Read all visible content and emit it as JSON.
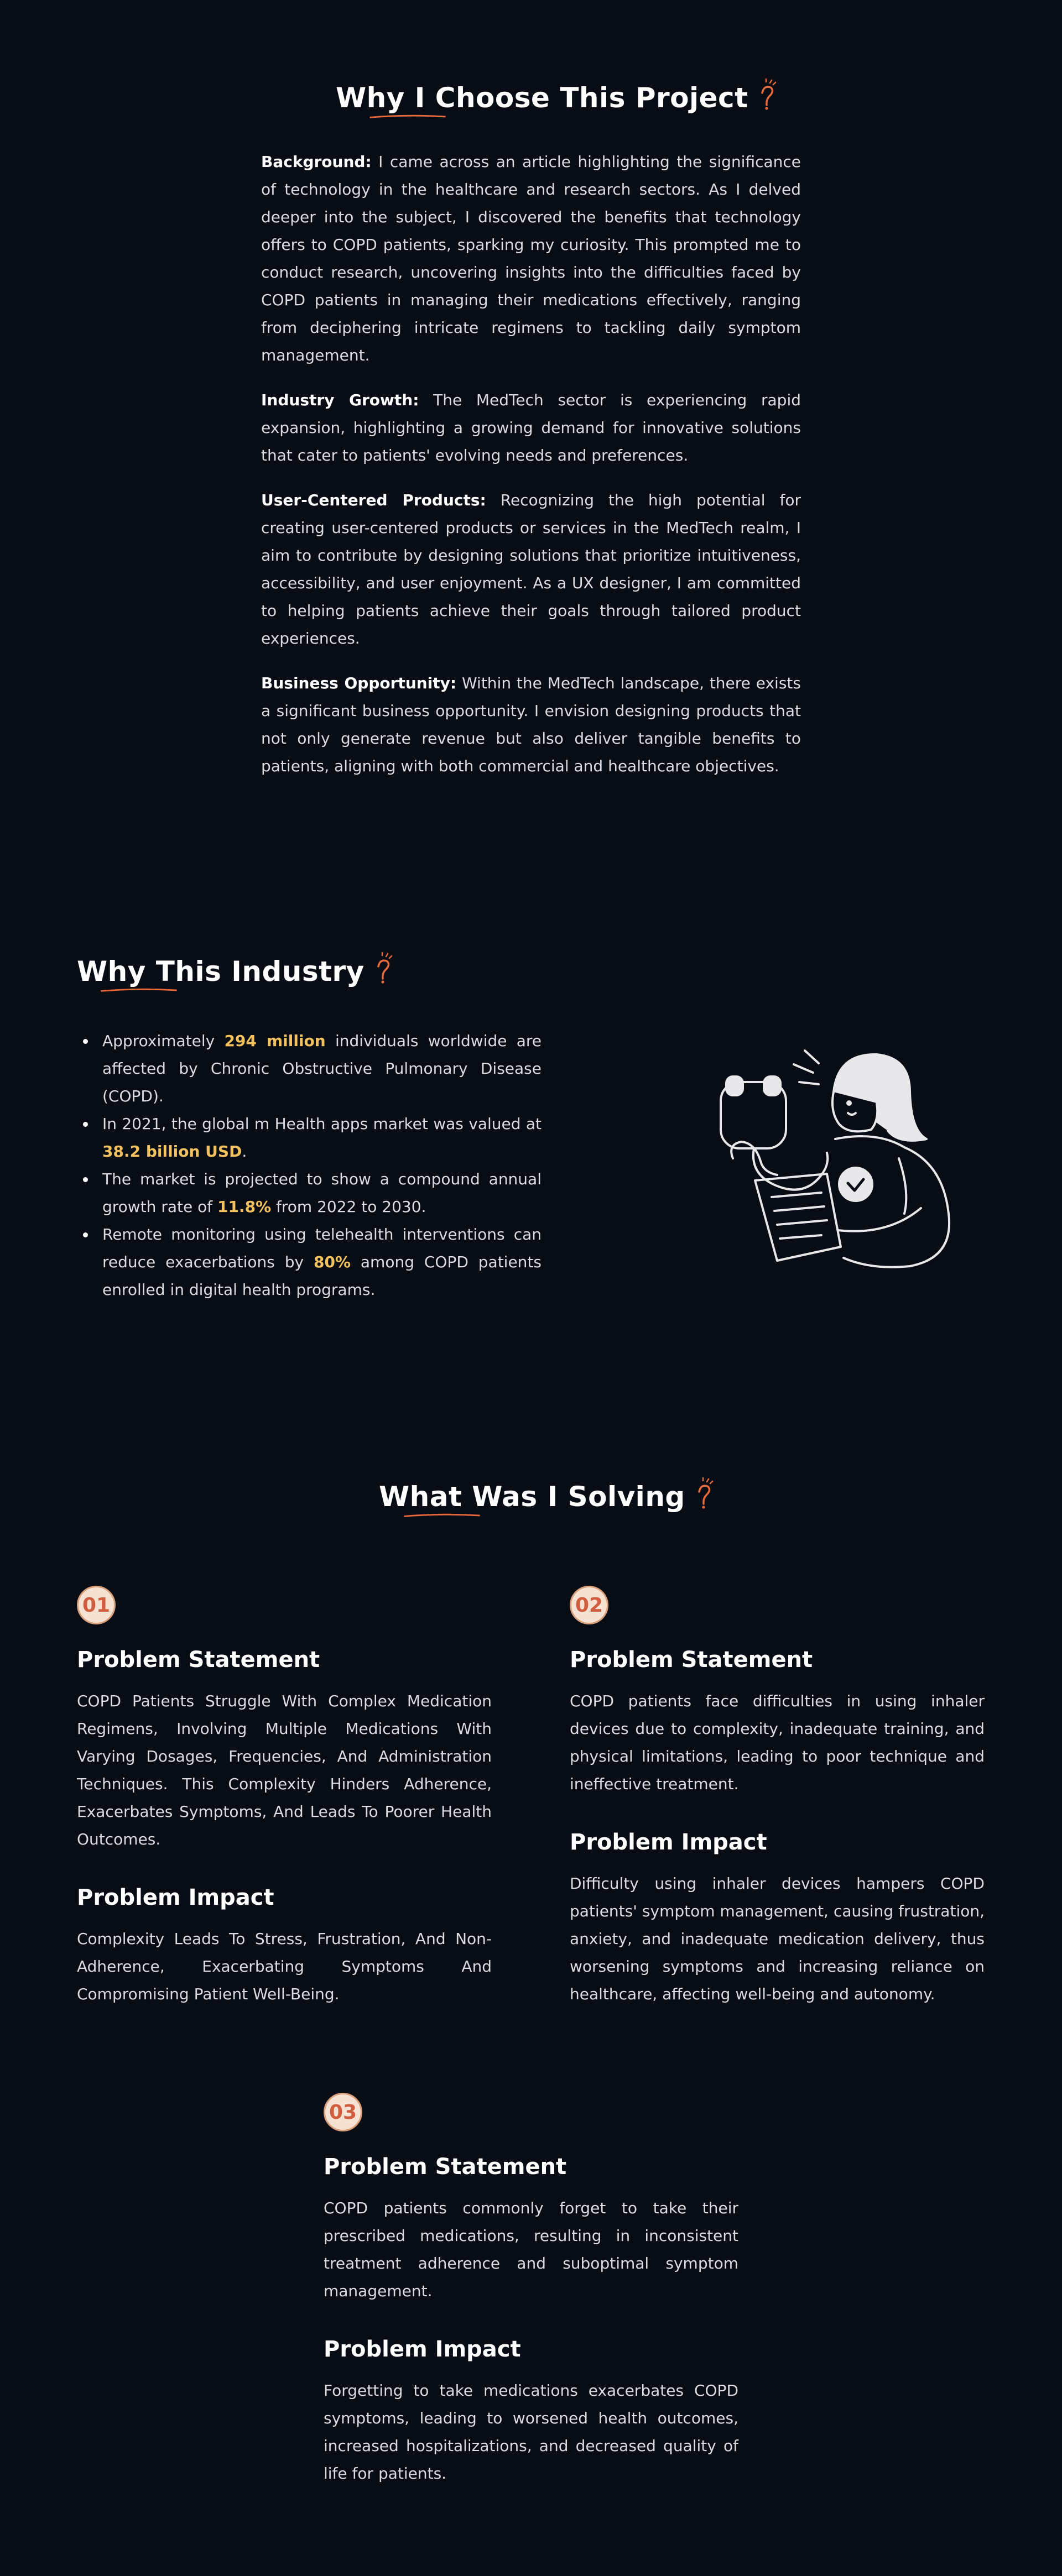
{
  "colors": {
    "background": "#080c15",
    "accent": "#e66a3c",
    "highlight": "#f3c25e",
    "badge_bg": "#f6e2d3",
    "badge_text": "#d05d3d"
  },
  "project": {
    "title": "Why I Choose This Project",
    "paragraphs": [
      {
        "label": "Background:",
        "text": " I came across an article highlighting the significance of technology in the healthcare and research sectors. As I delved deeper into the subject, I discovered the benefits that technology offers to COPD patients, sparking my curiosity. This prompted me to conduct research, uncovering insights into the difficulties faced by COPD patients in managing their medications effectively, ranging from deciphering intricate regimens to tackling daily symptom management."
      },
      {
        "label": "Industry Growth:",
        "text": " The MedTech sector is experiencing rapid expansion, highlighting a growing demand for innovative solutions that cater to patients' evolving needs and preferences."
      },
      {
        "label": "User-Centered Products:",
        "text": " Recognizing the high potential for creating user-centered products or services in the MedTech realm, I aim to contribute by designing solutions that prioritize intuitiveness, accessibility, and user enjoyment. As a UX designer, I am committed to helping patients achieve their goals through tailored product experiences."
      },
      {
        "label": "Business Opportunity:",
        "text": " Within the MedTech landscape, there exists a significant business opportunity. I envision designing products that not only generate revenue but also deliver tangible benefits to patients, aligning with both commercial and healthcare objectives."
      }
    ]
  },
  "industry": {
    "title": "Why This Industry",
    "illustration_icon": "doctor-with-stethoscope-illustration",
    "bullets": [
      {
        "before": "Approximately ",
        "highlight": "294 million",
        "after": " individuals worldwide are affected by Chronic Obstructive Pulmonary Disease (COPD)."
      },
      {
        "before": "In 2021, the global m Health apps market was valued at ",
        "highlight": "38.2 billion USD",
        "after": "."
      },
      {
        "before": "The market is projected to show a compound annual growth rate of ",
        "highlight": "11.8%",
        "after": " from 2022 to 2030."
      },
      {
        "before": "Remote monitoring using telehealth interventions can reduce exacerbations by ",
        "highlight": "80%",
        "after": " among COPD patients enrolled in digital health programs."
      }
    ]
  },
  "solving": {
    "title": "What Was I Solving",
    "cards": [
      {
        "number": "01",
        "statement_title": "Problem Statement",
        "statement": "COPD Patients Struggle With Complex Medication Regimens, Involving Multiple Medications With Varying Dosages, Frequencies, And Administration Techniques. This Complexity Hinders Adherence, Exacerbates Symptoms, And Leads To Poorer Health Outcomes.",
        "impact_title": "Problem Impact",
        "impact": "Complexity Leads To Stress, Frustration, And Non-Adherence, Exacerbating Symptoms And Compromising Patient Well-Being."
      },
      {
        "number": "02",
        "statement_title": "Problem Statement",
        "statement": "COPD patients face difficulties in using inhaler devices due to complexity, inadequate training, and physical limitations, leading to poor technique and ineffective treatment.",
        "impact_title": "Problem Impact",
        "impact": "Difficulty using inhaler devices hampers COPD patients' symptom management, causing frustration, anxiety, and inadequate medication delivery, thus worsening symptoms and increasing reliance on healthcare, affecting well-being and autonomy."
      },
      {
        "number": "03",
        "statement_title": "Problem Statement",
        "statement": "COPD patients commonly forget to take their prescribed medications, resulting in inconsistent treatment adherence and suboptimal symptom management.",
        "impact_title": "Problem Impact",
        "impact": "Forgetting to take medications exacerbates COPD symptoms, leading to worsened health outcomes, increased hospitalizations, and decreased quality of life for patients."
      }
    ]
  }
}
